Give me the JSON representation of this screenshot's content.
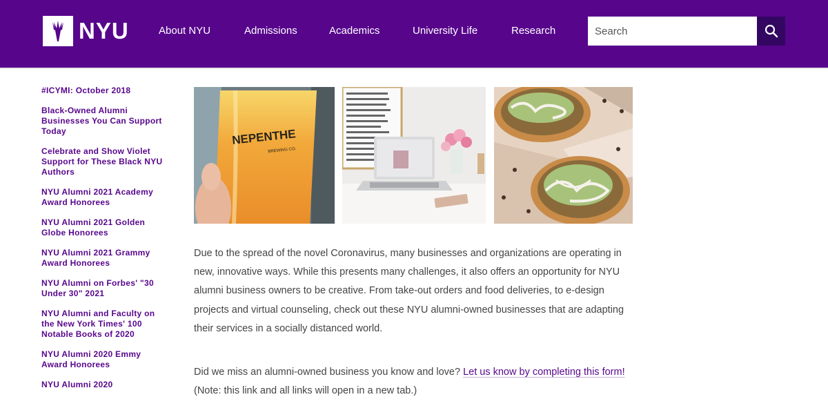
{
  "header": {
    "logo_text": "NYU",
    "nav": [
      {
        "label": "About NYU"
      },
      {
        "label": "Admissions"
      },
      {
        "label": "Academics"
      },
      {
        "label": "University Life"
      },
      {
        "label": "Research"
      }
    ],
    "search_placeholder": "Search",
    "search_icon": "search-icon",
    "brand_color": "#57068c",
    "search_button_color": "#330662"
  },
  "sidebar": {
    "items": [
      {
        "label": "#ICYMI: October 2018"
      },
      {
        "label": "Black-Owned Alumni Businesses You Can Support Today"
      },
      {
        "label": "Celebrate and Show Violet Support for These Black NYU Authors"
      },
      {
        "label": "NYU Alumni 2021 Academy Award Honorees"
      },
      {
        "label": "NYU Alumni 2021 Golden Globe Honorees"
      },
      {
        "label": "NYU Alumni 2021 Grammy Award Honorees"
      },
      {
        "label": "NYU Alumni on Forbes' \"30 Under 30\" 2021"
      },
      {
        "label": "NYU Alumni and Faculty on the New York Times' 100 Notable Books of 2020"
      },
      {
        "label": "NYU Alumni 2020 Emmy Award Honorees"
      },
      {
        "label": "NYU Alumni 2020"
      }
    ]
  },
  "photos": {
    "beer_glass_text": "NEPENTHE",
    "beer_glass_subtext": "BREWING CO."
  },
  "main": {
    "paragraph1": "Due to the spread of the novel Coronavirus, many businesses and organizations are operating in new, innovative ways. While this presents many challenges, it also offers an opportunity for NYU alumni business owners to be creative. From take-out orders and food deliveries, to e-design projects and virtual counseling, check out these NYU alumni-owned businesses that are adapting their services in a socially distanced world.",
    "paragraph2_before": "Did we miss an alumni-owned business you know and love? ",
    "paragraph2_link": "Let us know by completing this form!",
    "paragraph2_after": " (Note: this link and all links will open in a new tab.)"
  }
}
